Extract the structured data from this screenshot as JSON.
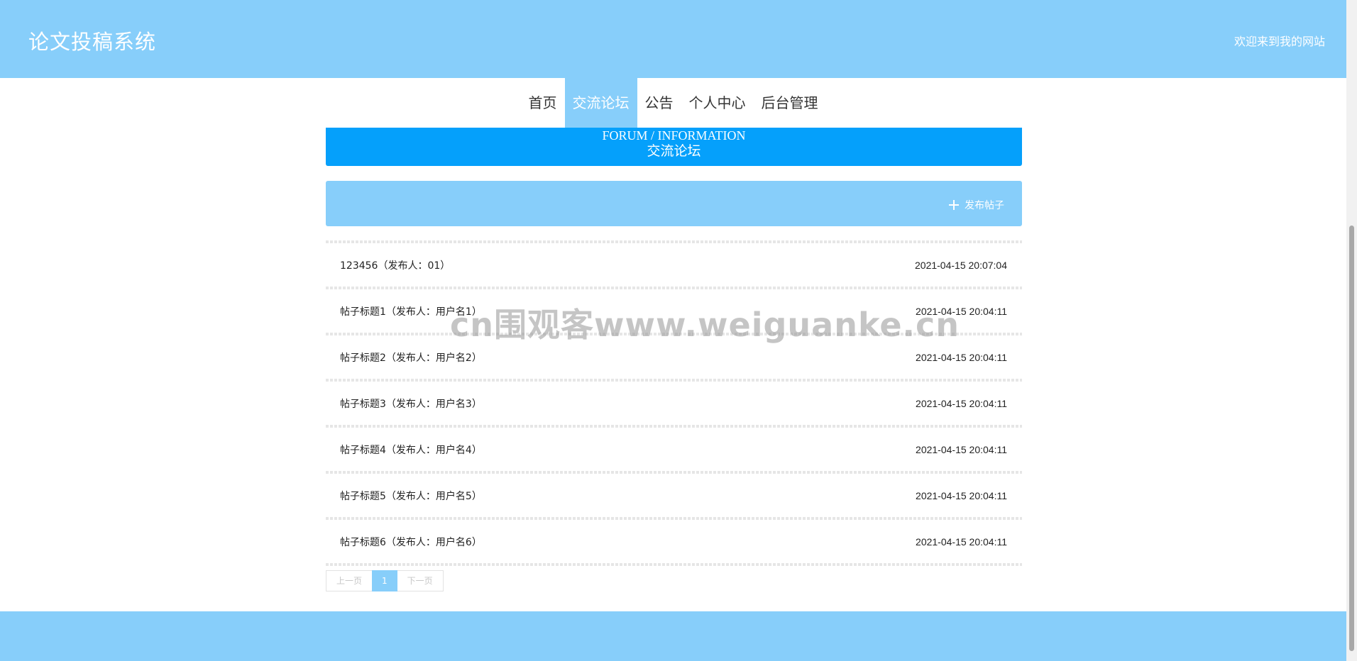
{
  "header": {
    "site_title": "论文投稿系统",
    "welcome_text": "欢迎来到我的网站"
  },
  "nav": {
    "items": [
      {
        "label": "首页",
        "active": false
      },
      {
        "label": "交流论坛",
        "active": true
      },
      {
        "label": "公告",
        "active": false
      },
      {
        "label": "个人中心",
        "active": false
      },
      {
        "label": "后台管理",
        "active": false
      }
    ]
  },
  "banner": {
    "title_en": "FORUM / INFORMATION",
    "title_cn": "交流论坛"
  },
  "action_bar": {
    "publish_label": "发布帖子",
    "publish_icon": "plus-icon"
  },
  "posts": [
    {
      "title": "123456（发布人：01）",
      "time": "2021-04-15 20:07:04"
    },
    {
      "title": "帖子标题1（发布人：用户名1）",
      "time": "2021-04-15 20:04:11"
    },
    {
      "title": "帖子标题2（发布人：用户名2）",
      "time": "2021-04-15 20:04:11"
    },
    {
      "title": "帖子标题3（发布人：用户名3）",
      "time": "2021-04-15 20:04:11"
    },
    {
      "title": "帖子标题4（发布人：用户名4）",
      "time": "2021-04-15 20:04:11"
    },
    {
      "title": "帖子标题5（发布人：用户名5）",
      "time": "2021-04-15 20:04:11"
    },
    {
      "title": "帖子标题6（发布人：用户名6）",
      "time": "2021-04-15 20:04:11"
    }
  ],
  "pagination": {
    "prev_label": "上一页",
    "current_page": "1",
    "next_label": "下一页"
  },
  "watermark": "cn围观客www.weiguanke.cn",
  "colors": {
    "header_bg": "#87cefa",
    "banner_bg": "#05a0fb",
    "text": "#222222"
  }
}
